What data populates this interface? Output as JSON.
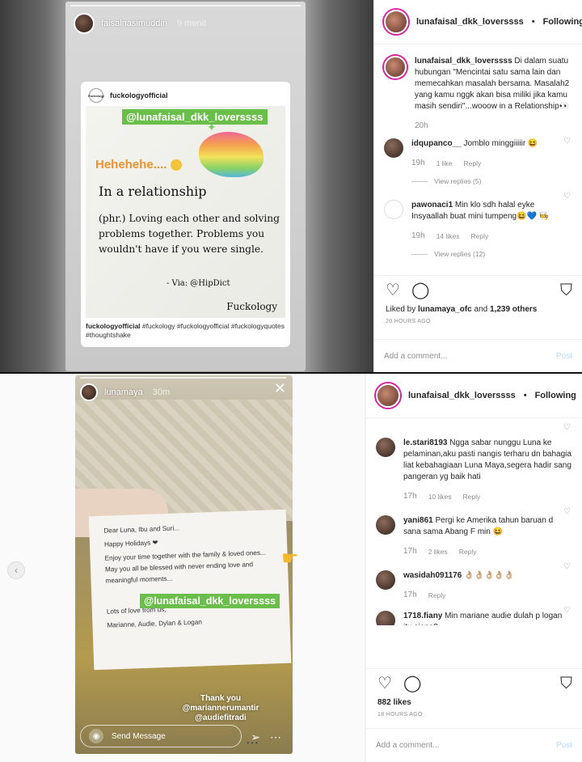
{
  "top": {
    "story": {
      "username": "faisalnasimuddin",
      "time": "9 menit",
      "card_account": "fuckologyofficial",
      "card_logo_text": "Fuckology",
      "mention": "@lunafaisal_dkk_loverssss",
      "hehe": "Hehehehe....",
      "title": "In a relationship",
      "definition": "(phr.) Loving each other and solving problems together. Problems you wouldn't have if you were single.",
      "via": "- Via: @HipDict",
      "brand": "Fuckology",
      "caption_user": "fuckologyofficial",
      "caption_tags": "#fuckology #fuckologyofficial #fuckologyquotes #thoughtshake"
    },
    "post": {
      "username": "lunafaisal_dkk_loverssss",
      "follow": "Following",
      "caption_user": "lunafaisal_dkk_loverssss",
      "caption_text": "Di dalam suatu hubungan \"Mencintai satu sama lain dan memecahkan masalah bersama. Masalah2 yang kamu nggk akan bisa miliki jika kamu masih sendiri\"...wooow in a Relationship👀",
      "caption_time": "20h",
      "comments": [
        {
          "user": "idqupanco__",
          "text": "Jomblo minggiiiiir 😆",
          "time": "19h",
          "likes": "1 like",
          "reply": "Reply",
          "replies": "View replies (5)"
        },
        {
          "user": "pawonaci1",
          "text": "Min klo sdh halal eyke Insyaallah buat mini tumpeng😆💙 🧑‍🍳",
          "time": "19h",
          "likes": "14 likes",
          "reply": "Reply",
          "replies": "View replies (12)"
        }
      ],
      "liked_by": "Liked by",
      "liked_user": "lunamaya_ofc",
      "liked_and": "and",
      "liked_others": "1,239 others",
      "ago": "20 HOURS AGO",
      "add_comment": "Add a comment...",
      "post_label": "Post"
    }
  },
  "bottom": {
    "story": {
      "username": "lunamaya",
      "time": "30m",
      "close": "✕",
      "letter_lines": [
        "Dear Luna, Ibu and Suri...",
        "Happy Holidays ❤",
        "Enjoy your time together with the family & loved ones... May you all be blessed with never ending love and meaningful moments...",
        "Lots of love from us,",
        "Marianne, Audie, Dylan & Logan"
      ],
      "mention": "@lunafaisal_dkk_loverssss",
      "thanks": "Thank you",
      "thanks_user1": "@mariannerumantir",
      "thanks_user2": "@audiefitradi",
      "send_message": "Send Message"
    },
    "post": {
      "username": "lunafaisal_dkk_loverssss",
      "follow": "Following",
      "comments": [
        {
          "user": "le.stari8193",
          "text": "Ngga sabar nunggu Luna ke pelaminan,aku pasti nangis terharu dn bahagia liat kebahagiaan Luna Maya,segera hadir sang pangeran yg baik hati",
          "time": "17h",
          "likes": "10 likes",
          "reply": "Reply"
        },
        {
          "user": "yani861",
          "text": "Pergi ke Amerika tahun baruan d sana sama Abang F min 😆",
          "time": "17h",
          "likes": "2 likes",
          "reply": "Reply"
        },
        {
          "user": "wasidah091176",
          "text": "👌🏼👌🏼👌🏼👌🏼👌🏼",
          "time": "17h",
          "likes": "",
          "reply": "Reply"
        },
        {
          "user": "1718.fiany",
          "text": "Min mariane audie dulah p logan itu siapa?",
          "time": "",
          "likes": "",
          "reply": ""
        }
      ],
      "likes_count": "882 likes",
      "ago": "18 HOURS AGO",
      "add_comment": "Add a comment...",
      "post_label": "Post"
    }
  }
}
